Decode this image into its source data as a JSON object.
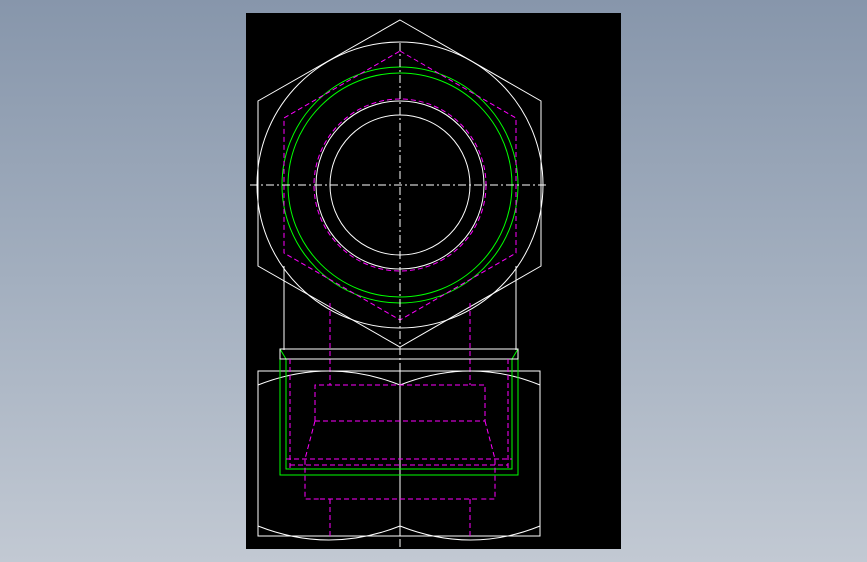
{
  "viewport": {
    "background": "#000000"
  },
  "layers": {
    "outline": {
      "color": "#ffffff"
    },
    "thread": {
      "color": "#00ff00"
    },
    "hidden": {
      "color": "#ff00ff"
    },
    "center": {
      "color": "#ffffff"
    }
  },
  "views": [
    {
      "id": "top-view",
      "features": [
        "hex-outline",
        "chamfer-circle",
        "thread-major",
        "thread-minor",
        "bore",
        "hidden-hex",
        "centerlines"
      ]
    },
    {
      "id": "front-view",
      "features": [
        "hex-body",
        "chamfer-arcs",
        "thread-section",
        "hidden-bore",
        "centerline"
      ]
    }
  ]
}
